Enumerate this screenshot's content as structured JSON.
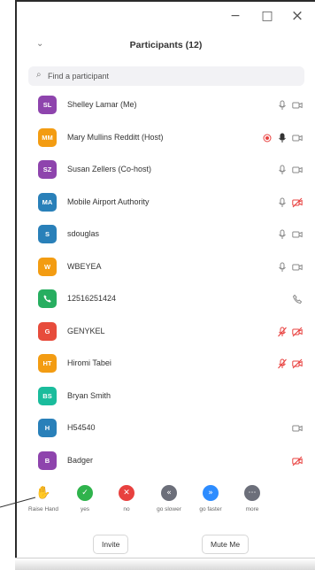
{
  "window": {
    "minimize_glyph": "−",
    "maximize_glyph": "□",
    "close_glyph": "×"
  },
  "panel": {
    "title": "Participants (12)",
    "collapse_glyph": "⌄"
  },
  "search": {
    "placeholder": "Find a participant"
  },
  "participants": [
    {
      "initials": "SL",
      "name": "Shelley Lamar (Me)",
      "color": "#8e44ad",
      "icons": [
        "mic",
        "video"
      ]
    },
    {
      "initials": "MM",
      "name": "Mary Mullins Redditt (Host)",
      "color": "#f39c12",
      "icons": [
        "record",
        "mic-active",
        "video"
      ]
    },
    {
      "initials": "SZ",
      "name": "Susan Zellers (Co-host)",
      "color": "#8e44ad",
      "icons": [
        "mic",
        "video"
      ]
    },
    {
      "initials": "MA",
      "name": "Mobile Airport Authority",
      "color": "#2980b9",
      "icons": [
        "mic",
        "video-off"
      ]
    },
    {
      "initials": "S",
      "name": "sdouglas",
      "color": "#2980b9",
      "icons": [
        "mic",
        "video"
      ]
    },
    {
      "initials": "W",
      "name": "WBEYEA",
      "color": "#f39c12",
      "icons": [
        "mic",
        "video"
      ]
    },
    {
      "initials": "",
      "name": "12516251424",
      "color": "#27ae60",
      "icons": [
        "phone"
      ],
      "phone": true
    },
    {
      "initials": "G",
      "name": "GENYKEL",
      "color": "#e74c3c",
      "icons": [
        "mic-off",
        "video-off"
      ]
    },
    {
      "initials": "HT",
      "name": "Hiromi Tabei",
      "color": "#f39c12",
      "icons": [
        "mic-off",
        "video-off"
      ]
    },
    {
      "initials": "BS",
      "name": "Bryan Smith",
      "color": "#1abc9c",
      "icons": []
    },
    {
      "initials": "H",
      "name": "H54540",
      "color": "#2980b9",
      "icons": [
        "video"
      ]
    },
    {
      "initials": "B",
      "name": "Badger",
      "color": "#8e44ad",
      "icons": [
        "video-off"
      ]
    }
  ],
  "feedback": [
    {
      "label": "Raise Hand",
      "color": "#2d8cff",
      "glyph": "✋"
    },
    {
      "label": "yes",
      "color": "#2fb34c",
      "glyph": "✓"
    },
    {
      "label": "no",
      "color": "#e8413f",
      "glyph": "✕"
    },
    {
      "label": "go slower",
      "color": "#6c6f7a",
      "glyph": "«"
    },
    {
      "label": "go faster",
      "color": "#2d8cff",
      "glyph": "»"
    },
    {
      "label": "more",
      "color": "#6c6f7a",
      "glyph": "⋯"
    }
  ],
  "actions": {
    "invite": "Invite",
    "mute_me": "Mute Me"
  }
}
